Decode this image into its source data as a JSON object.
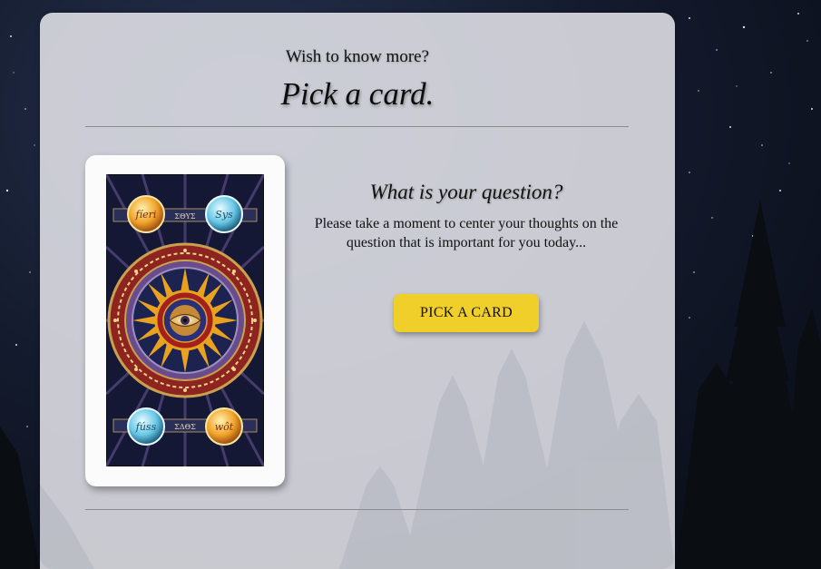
{
  "header": {
    "subtitle": "Wish to know more?",
    "title": "Pick a card."
  },
  "question": {
    "heading": "What is your question?",
    "body": "Please take a moment to center your thoughts on the question that is important for you today..."
  },
  "actions": {
    "pick_card_label": "PICK A CARD"
  },
  "card": {
    "corner_labels": [
      "fíeri",
      "Sys",
      "fúss",
      "wôt"
    ],
    "band_texts": [
      "ΣΘΥΣ",
      "ΣΔΘΣ"
    ]
  },
  "colors": {
    "panel": "#e8e8ee",
    "button": "#f0cf2a",
    "card_red": "#8e2420",
    "card_navy": "#1d2350",
    "card_gold": "#e9a21f"
  }
}
